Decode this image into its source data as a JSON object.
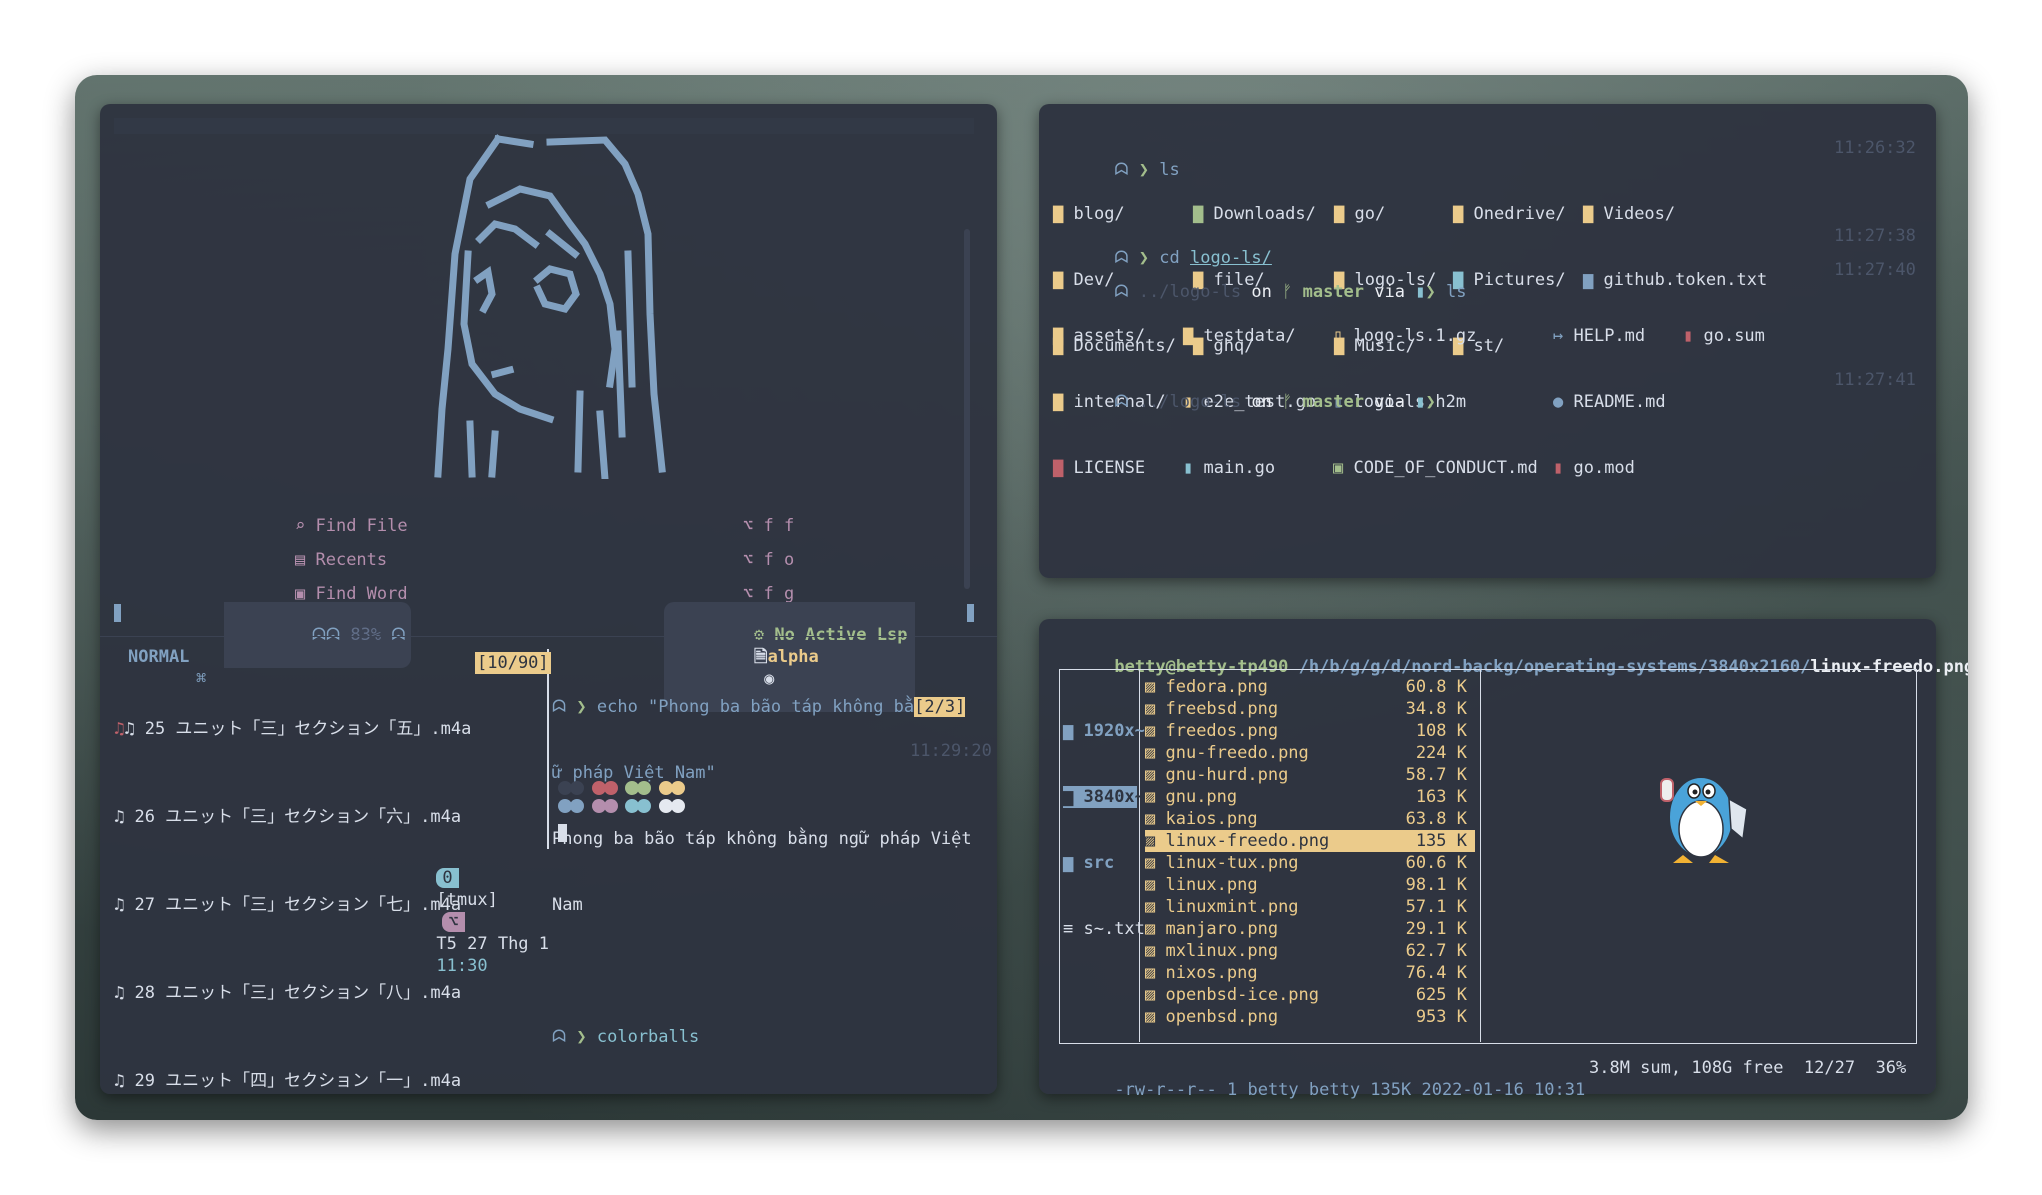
{
  "left_top": {
    "dashboard": [
      {
        "icon": "search-icon",
        "label": "Find File",
        "shortcut": "⌥ f f"
      },
      {
        "icon": "recents-icon",
        "label": "Recents",
        "shortcut": "⌥ f o"
      },
      {
        "icon": "word-icon",
        "label": "Find Word",
        "shortcut": "⌥ f g"
      }
    ],
    "statusline": {
      "mode": "NORMAL",
      "mode_icon": "⌘",
      "percent": "83%",
      "lsp": "No Active Lsp",
      "filetype": "alpha"
    }
  },
  "left_bottom": {
    "counter": "[10/90]",
    "files": [
      "♫ 25 ユニット「三」セクション「五」.m4a",
      "♫ 26 ユニット「三」セクション「六」.m4a",
      "♫ 27 ユニット「三」セクション「七」.m4a",
      "♫ 28 ユニット「三」セクション「八」.m4a",
      "♫ 29 ユニット「四」セクション「一」.m4a"
    ],
    "shell": {
      "echo_cmd": "echo \"Phong ba bão táp không bằ",
      "echo_counter": "[2/3]",
      "echo_cont": "ữ pháp Việt Nam\"",
      "echo_out1": "Phong ba bão táp không bằng ngữ pháp Việt",
      "echo_out2": "Nam",
      "cmd2": "colorballs",
      "time2": "11:29:20"
    },
    "tmux": {
      "win": "0",
      "name": "[tmux]",
      "icon": "⌥",
      "date": "T5 27 Thg 1",
      "time": "11:30"
    }
  },
  "right_top": {
    "cmd1": "ls",
    "time1": "11:26:32",
    "ls1": [
      [
        "blog/",
        "Downloads/",
        "go/",
        "Onedrive/",
        "Videos/"
      ],
      [
        "Dev/",
        "file/",
        "logo-ls/",
        "Pictures/",
        "github.token.txt"
      ],
      [
        "Documents/",
        "ghq/",
        "Music/",
        "st/",
        ""
      ]
    ],
    "cmd2_pre": "cd ",
    "cmd2_arg": "logo-ls/",
    "time2": "11:27:38",
    "path": "../logo-ls",
    "on": "on",
    "branch": "master",
    "via": "via",
    "cmd3": "ls",
    "time3": "11:27:40",
    "ls2": [
      [
        "assets/",
        "testdata/",
        "logo-ls.1.gz",
        "HELP.md",
        "go.sum"
      ],
      [
        "internal/",
        "e2e_test.go",
        "logo-ls.h2m",
        "README.md",
        ""
      ],
      [
        "LICENSE",
        "main.go",
        "CODE_OF_CONDUCT.md",
        "go.mod",
        ""
      ]
    ],
    "time4": "11:27:41"
  },
  "right_bottom": {
    "header_user": "betty@betty-tp490",
    "header_path": " /h/b/g/g/d/nord-backg/operating-systems/3840x2160/",
    "header_file": "linux-freedo.png",
    "dirs": [
      "1920x~",
      "3840x~",
      "src",
      "s~.txt"
    ],
    "files": [
      {
        "name": "fedora.png",
        "size": "60.8 K"
      },
      {
        "name": "freebsd.png",
        "size": "34.8 K"
      },
      {
        "name": "freedos.png",
        "size": "108 K"
      },
      {
        "name": "gnu-freedo.png",
        "size": "224 K"
      },
      {
        "name": "gnu-hurd.png",
        "size": "58.7 K"
      },
      {
        "name": "gnu.png",
        "size": "163 K"
      },
      {
        "name": "kaios.png",
        "size": "63.8 K"
      },
      {
        "name": "linux-freedo.png",
        "size": "135 K"
      },
      {
        "name": "linux-tux.png",
        "size": "60.6 K"
      },
      {
        "name": "linux.png",
        "size": "98.1 K"
      },
      {
        "name": "linuxmint.png",
        "size": "57.1 K"
      },
      {
        "name": "manjaro.png",
        "size": "29.1 K"
      },
      {
        "name": "mxlinux.png",
        "size": "62.7 K"
      },
      {
        "name": "nixos.png",
        "size": "76.4 K"
      },
      {
        "name": "openbsd-ice.png",
        "size": "625 K"
      },
      {
        "name": "openbsd.png",
        "size": "953 K"
      }
    ],
    "status_left": "-rw-r--r-- 1 betty betty 135K 2022-01-16 10:31",
    "status_right": "3.8M sum, 108G free  12/27  36%"
  },
  "colors": {
    "bg": "#2e3440",
    "accent": "#88c0d0",
    "highlight": "#ebcb8b"
  }
}
